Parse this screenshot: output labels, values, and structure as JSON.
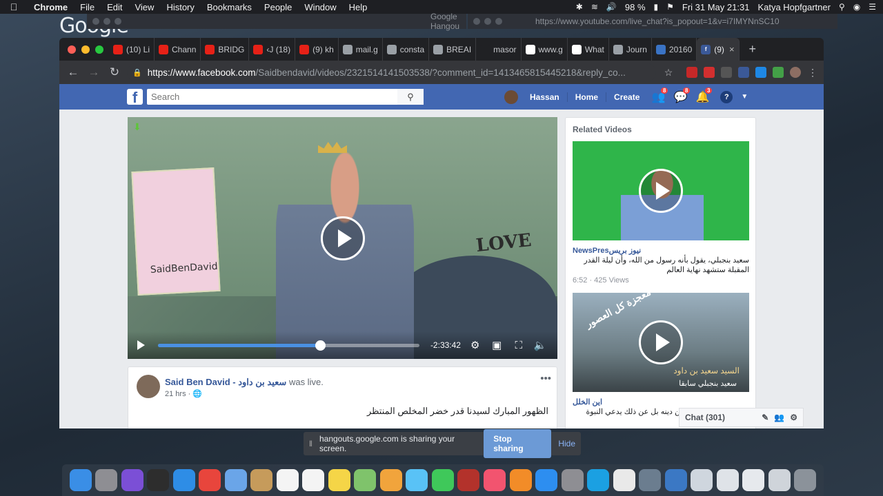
{
  "desktop": {
    "logo": "Google"
  },
  "menubar": {
    "app_name": "Chrome",
    "items": [
      "File",
      "Edit",
      "View",
      "History",
      "Bookmarks",
      "People",
      "Window",
      "Help"
    ],
    "battery": "98 %",
    "datetime": "Fri 31 May  21:31",
    "user": "Katya Hopfgartner"
  },
  "background_windows": {
    "hangouts_title": "Google Hangou",
    "youtube_url": "https://www.youtube.com/live_chat?is_popout=1&v=i7IMYNnSC10"
  },
  "browser": {
    "tabs": [
      {
        "label": "(10) Li",
        "color": "#e62117"
      },
      {
        "label": "Chann",
        "color": "#e62117"
      },
      {
        "label": "BRIDG",
        "color": "#e62117"
      },
      {
        "label": "‹J (18)",
        "color": "#e62117"
      },
      {
        "label": "(9) kh",
        "color": "#e62117"
      },
      {
        "label": "mail.g",
        "color": "#9aa0a6"
      },
      {
        "label": "consta",
        "color": "#9aa0a6"
      },
      {
        "label": "BREAI",
        "color": "#9aa0a6"
      },
      {
        "label": "masor",
        "color": "#202124"
      },
      {
        "label": "www.g",
        "color": "#ffffff"
      },
      {
        "label": "What",
        "color": "#ffffff"
      },
      {
        "label": "Journ",
        "color": "#9aa0a6"
      },
      {
        "label": "20160",
        "color": "#3a73c4"
      }
    ],
    "active_tab": {
      "label": "(9)",
      "color": "#3b5998"
    },
    "url_host": "https://www.facebook.com",
    "url_path": "/Saidbendavid/videos/2321514141503538/?comment_id=1413465815445218&reply_co..."
  },
  "facebook": {
    "search_placeholder": "Search",
    "nav": {
      "user": "Hassan",
      "home": "Home",
      "create": "Create",
      "friend_badge": "8",
      "message_badge": "8",
      "notification_badge": "3",
      "help": "?"
    },
    "video": {
      "box_label": "SaidBenDavid",
      "love_text": "LOVE",
      "time_remaining": "-2:33:42",
      "progress": 0.62
    },
    "post": {
      "author": "Said Ben David - سعيد بن داود",
      "status": "was live.",
      "time": "21 hrs",
      "text": "الظهور المبارك لسيدنا قدر خضر المخلص المنتظر"
    },
    "related": {
      "title": "Related Videos",
      "items": [
        {
          "source": "NewsPresنيوز بريس",
          "description": "سعيد بنجبلي، يقول بأنه رسول من الله، وأن ليلة القدر المقبلة ستشهد نهاية العالم",
          "stats": "6:52 · 425 Views"
        },
        {
          "source": "اين الخلل",
          "banner": "معجزة كل العصور",
          "caption1": "السيد سعيد بن داود",
          "caption2": "سعيد بنجبلي سابقا",
          "description": "سعيد بن داود المرتد عن دينه بل عن ذلك يدعي النبوة المشروطة بوص"
        }
      ]
    },
    "chat": {
      "label": "Chat (301)"
    }
  },
  "sharebar": {
    "message": "hangouts.google.com is sharing your screen.",
    "stop_label": "Stop sharing",
    "hide_label": "Hide"
  },
  "dock": {
    "items": [
      {
        "name": "finder-icon",
        "color": "#3a8ee6"
      },
      {
        "name": "launchpad-icon",
        "color": "#8e8e93"
      },
      {
        "name": "siri-icon",
        "color": "#7b4fd6"
      },
      {
        "name": "activity-icon",
        "color": "#2d2d2d"
      },
      {
        "name": "safari-icon",
        "color": "#2e8de6"
      },
      {
        "name": "chrome-icon",
        "color": "#e8453c"
      },
      {
        "name": "preview-icon",
        "color": "#6aa5e8"
      },
      {
        "name": "notes-icon",
        "color": "#c69b5b"
      },
      {
        "name": "calendar-icon",
        "color": "#f4f4f4"
      },
      {
        "name": "reminders-icon",
        "color": "#f4f4f4"
      },
      {
        "name": "stickies-icon",
        "color": "#f5d547"
      },
      {
        "name": "maps-icon",
        "color": "#7fc36b"
      },
      {
        "name": "photos-icon",
        "color": "#f1a43c"
      },
      {
        "name": "messages-icon",
        "color": "#59c2f6"
      },
      {
        "name": "facetime-icon",
        "color": "#3fc85a"
      },
      {
        "name": "photobooth-icon",
        "color": "#b3322b"
      },
      {
        "name": "music-icon",
        "color": "#f2546f"
      },
      {
        "name": "books-icon",
        "color": "#f28c28"
      },
      {
        "name": "appstore-icon",
        "color": "#2d8ef0"
      },
      {
        "name": "settings-icon",
        "color": "#8e8e93"
      },
      {
        "name": "skype-icon",
        "color": "#1ba0e2"
      },
      {
        "name": "textedit-icon",
        "color": "#e9e9e9"
      },
      {
        "name": "screenshot-icon",
        "color": "#6b7d8f"
      },
      {
        "name": "network-icon",
        "color": "#3b78c4"
      },
      {
        "name": "folder-icon",
        "color": "#cfd6de"
      },
      {
        "name": "printer-icon",
        "color": "#dfe3e8"
      },
      {
        "name": "downloads-icon",
        "color": "#e6e9ed"
      },
      {
        "name": "screen-icon",
        "color": "#cfd4da"
      },
      {
        "name": "trash-icon",
        "color": "#8b929a"
      }
    ]
  }
}
